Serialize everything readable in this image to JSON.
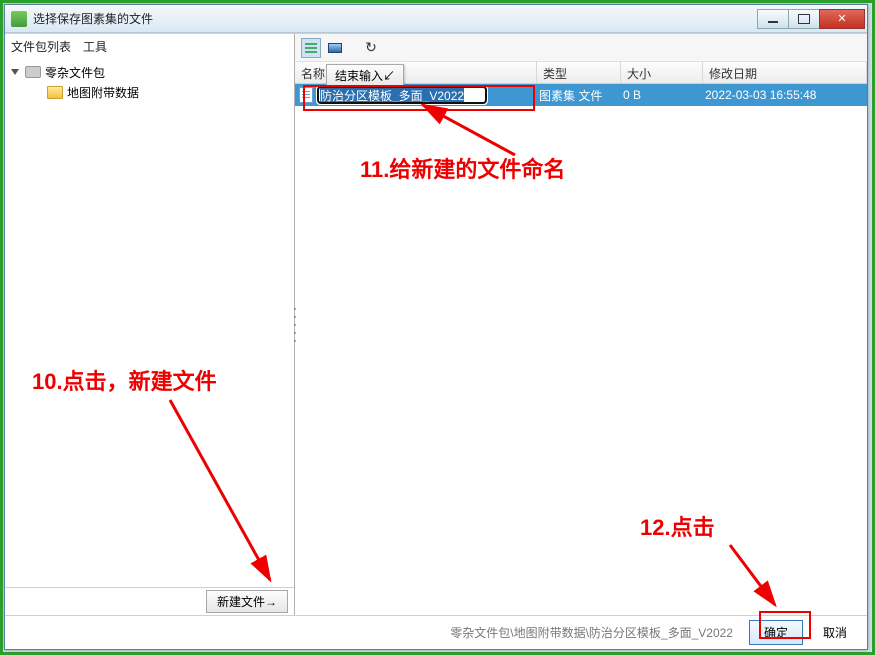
{
  "window": {
    "title": "选择保存图素集的文件"
  },
  "menubar": {
    "file_list": "文件包列表",
    "tools": "工具"
  },
  "tree": {
    "root": "零杂文件包",
    "child": "地图附带数据"
  },
  "left_actions": {
    "new_file": "新建文件→"
  },
  "columns": {
    "name": "名称",
    "type": "类型",
    "size": "大小",
    "date": "修改日期"
  },
  "popup": {
    "finish_input": "结束输入↙"
  },
  "row": {
    "filename": "防治分区模板_多面_V2022",
    "type": "图素集 文件",
    "size": "0 B",
    "date": "2022-03-03 16:55:48"
  },
  "bottom": {
    "path": "零杂文件包\\地图附带数据\\防治分区模板_多面_V2022",
    "ok": "确定",
    "cancel": "取消"
  },
  "annotations": {
    "a10": "10.点击，新建文件",
    "a11": "11.给新建的文件命名",
    "a12": "12.点击"
  }
}
